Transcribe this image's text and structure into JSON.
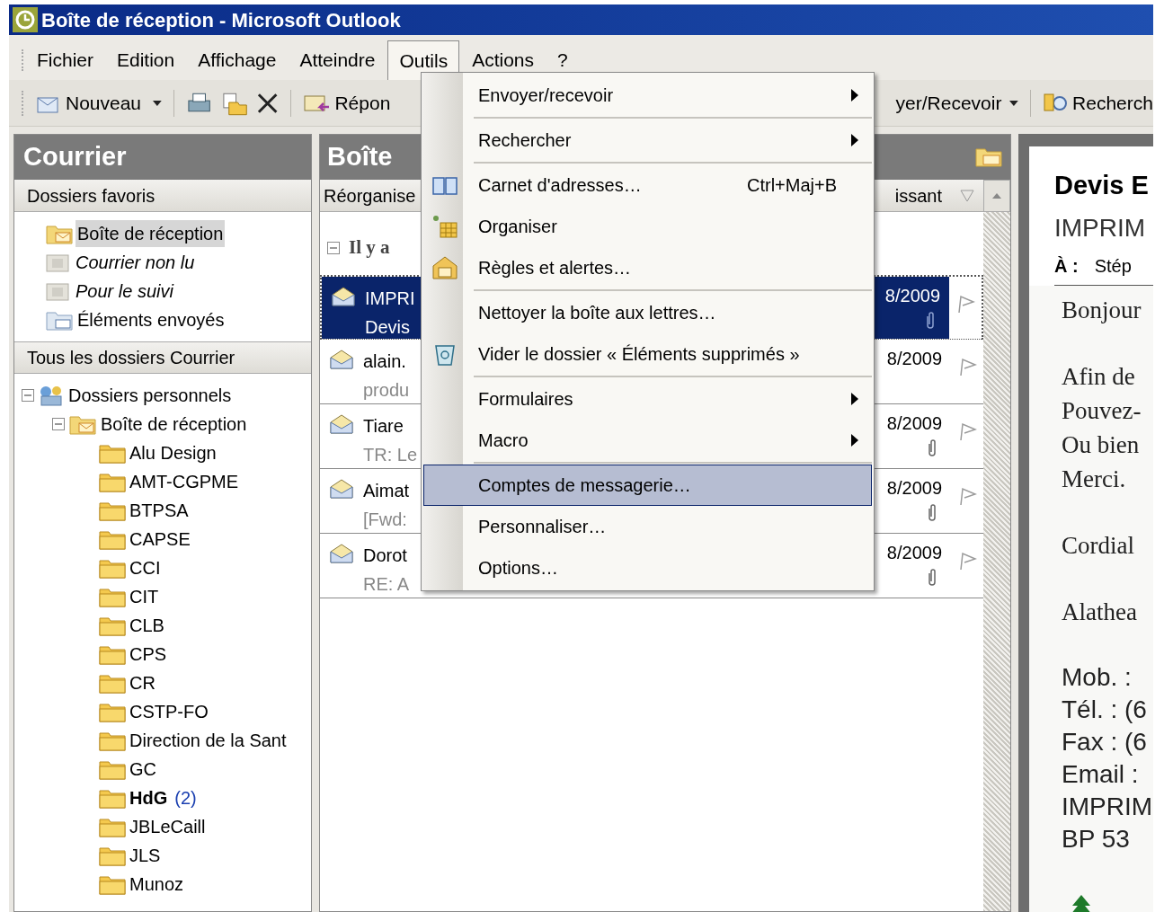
{
  "window": {
    "title": "Boîte de réception - Microsoft Outlook"
  },
  "menu_bar": [
    {
      "label": "Fichier",
      "selected": false
    },
    {
      "label": "Edition",
      "selected": false
    },
    {
      "label": "Affichage",
      "selected": false
    },
    {
      "label": "Atteindre",
      "selected": false
    },
    {
      "label": "Outils",
      "selected": true
    },
    {
      "label": "Actions",
      "selected": false
    },
    {
      "label": "?",
      "selected": false
    }
  ],
  "toolbar": {
    "new_label": "Nouveau",
    "reply_label": "Répon",
    "send_receive_label": "yer/Recevoir",
    "search_label": "Recherch"
  },
  "navigation": {
    "title": "Courrier",
    "favorites_title": "Dossiers favoris",
    "favorites": [
      {
        "label": "Boîte de réception",
        "kind": "inbox",
        "selected": true
      },
      {
        "label": "Courrier non lu",
        "kind": "search",
        "selected": false
      },
      {
        "label": "Pour le suivi",
        "kind": "search",
        "selected": false
      },
      {
        "label": "Éléments envoyés",
        "kind": "sent",
        "selected": false
      }
    ],
    "all_title": "Tous les dossiers Courrier",
    "tree": [
      {
        "label": "Dossiers personnels",
        "kind": "root",
        "expanded": true,
        "children": [
          {
            "label": "Boîte de réception",
            "kind": "inbox",
            "expanded": true,
            "children": [
              {
                "label": "Alu Design",
                "kind": "folder"
              },
              {
                "label": "AMT-CGPME",
                "kind": "folder"
              },
              {
                "label": "BTPSA",
                "kind": "folder"
              },
              {
                "label": "CAPSE",
                "kind": "folder"
              },
              {
                "label": "CCI",
                "kind": "folder"
              },
              {
                "label": "CIT",
                "kind": "folder"
              },
              {
                "label": "CLB",
                "kind": "folder"
              },
              {
                "label": "CPS",
                "kind": "folder"
              },
              {
                "label": "CR",
                "kind": "folder"
              },
              {
                "label": "CSTP-FO",
                "kind": "folder"
              },
              {
                "label": "Direction de la Sant",
                "kind": "folder"
              },
              {
                "label": "GC",
                "kind": "folder"
              },
              {
                "label": "HdG",
                "kind": "folder",
                "unread": "(2)"
              },
              {
                "label": "JBLeCaill",
                "kind": "folder"
              },
              {
                "label": "JLS",
                "kind": "folder"
              },
              {
                "label": "Munoz",
                "kind": "folder"
              }
            ]
          }
        ]
      }
    ]
  },
  "message_list": {
    "title": "Boîte",
    "arrange_label": "Réorganise",
    "sort_label": "issant",
    "group_label": "Il y a",
    "group_expanded": true,
    "messages": [
      {
        "sender": "IMPRI",
        "subject": "Devis",
        "date": "8/2009",
        "attachment": true,
        "selected": true
      },
      {
        "sender": "alain.",
        "subject": "produ",
        "date": "8/2009",
        "attachment": false,
        "selected": false
      },
      {
        "sender": "Tiare",
        "subject": "TR: Le",
        "date": "8/2009",
        "attachment": true,
        "selected": false
      },
      {
        "sender": "Aimat",
        "subject": "[Fwd:",
        "date": "8/2009",
        "attachment": true,
        "selected": false
      },
      {
        "sender": "Dorot",
        "subject": "RE: A",
        "date": "8/2009",
        "attachment": true,
        "selected": false
      }
    ]
  },
  "tools_menu": [
    {
      "kind": "item",
      "label": "Envoyer/recevoir",
      "submenu": true,
      "selected": false
    },
    {
      "kind": "separator"
    },
    {
      "kind": "item",
      "label": "Rechercher",
      "submenu": true,
      "selected": false
    },
    {
      "kind": "separator"
    },
    {
      "kind": "item",
      "label": "Carnet d'adresses…",
      "shortcut": "Ctrl+Maj+B",
      "submenu": false,
      "selected": false
    },
    {
      "kind": "item",
      "label": "Organiser",
      "submenu": false,
      "selected": false
    },
    {
      "kind": "item",
      "label": "Règles et alertes…",
      "submenu": false,
      "selected": false
    },
    {
      "kind": "separator"
    },
    {
      "kind": "item",
      "label": "Nettoyer la boîte aux lettres…",
      "submenu": false,
      "selected": false
    },
    {
      "kind": "item",
      "label": "Vider le dossier « Éléments supprimés »",
      "submenu": false,
      "selected": false
    },
    {
      "kind": "separator"
    },
    {
      "kind": "item",
      "label": "Formulaires",
      "submenu": true,
      "selected": false
    },
    {
      "kind": "item",
      "label": "Macro",
      "submenu": true,
      "selected": false
    },
    {
      "kind": "separator"
    },
    {
      "kind": "item",
      "label": "Comptes de messagerie…",
      "submenu": false,
      "selected": true
    },
    {
      "kind": "item",
      "label": "Personnaliser…",
      "submenu": false,
      "selected": false
    },
    {
      "kind": "item",
      "label": "Options…",
      "submenu": false,
      "selected": false
    }
  ],
  "reading_pane": {
    "subject": "Devis E",
    "sender": "IMPRIM",
    "to_label": "À :",
    "to": "Stép",
    "body": [
      {
        "text": "Bonjour",
        "kind": "serif"
      },
      {
        "kind": "gap"
      },
      {
        "text": "Afin de",
        "kind": "serif"
      },
      {
        "text": "Pouvez-",
        "kind": "serif"
      },
      {
        "text": "Ou bien",
        "kind": "serif"
      },
      {
        "text": "Merci.",
        "kind": "serif"
      },
      {
        "kind": "gap"
      },
      {
        "text": "Cordial",
        "kind": "serif"
      },
      {
        "kind": "gap"
      },
      {
        "text": "Alathea",
        "kind": "serif"
      },
      {
        "kind": "gap"
      },
      {
        "text": "Mob. :",
        "kind": "sans"
      },
      {
        "text": "Tél. : (6",
        "kind": "sans"
      },
      {
        "text": "Fax : (6",
        "kind": "sans"
      },
      {
        "text": "Email :",
        "kind": "sans"
      },
      {
        "text": "IMPRIM",
        "kind": "sans"
      },
      {
        "text": "BP 53",
        "kind": "sans"
      }
    ]
  }
}
